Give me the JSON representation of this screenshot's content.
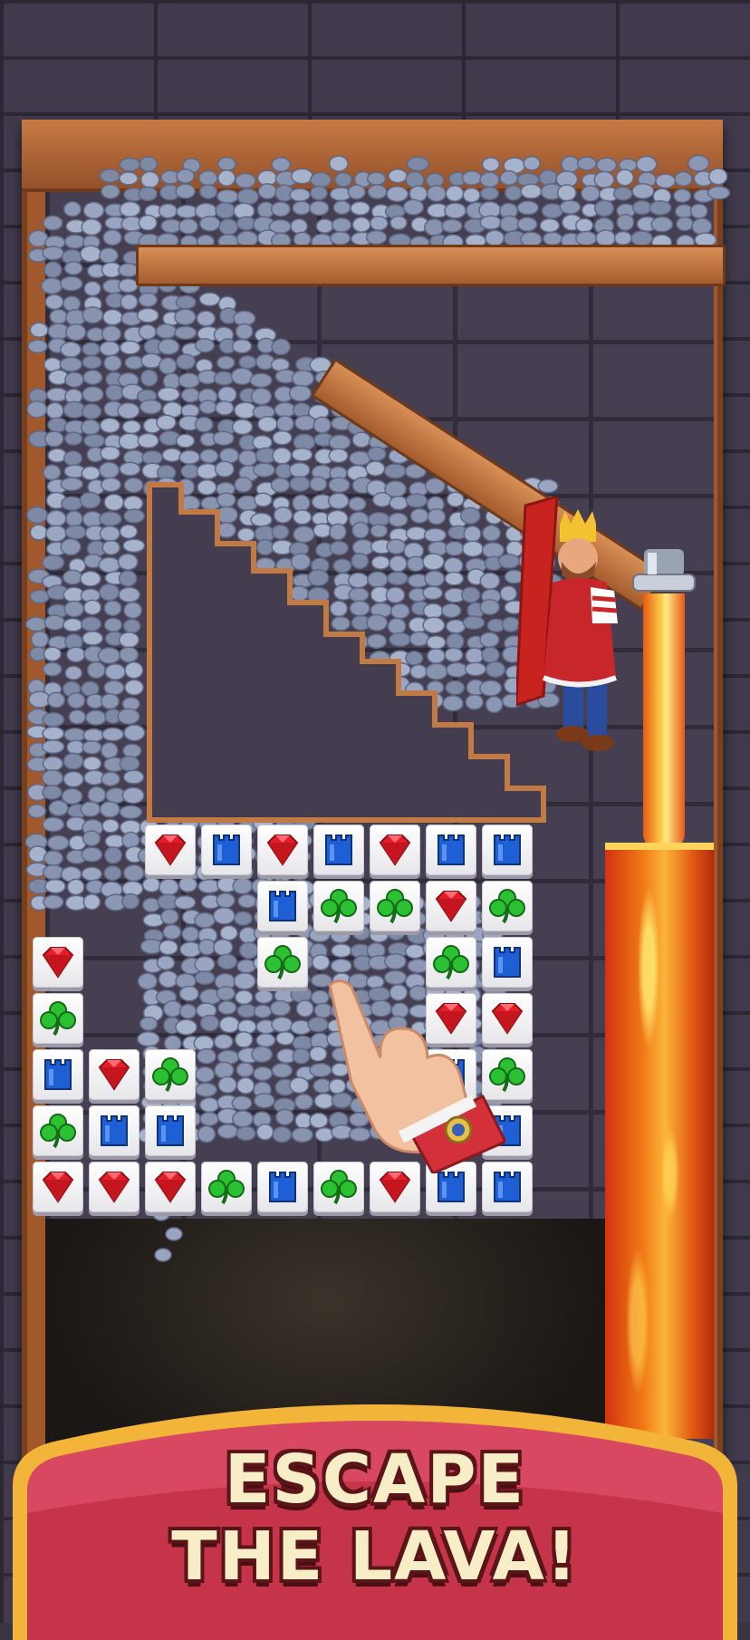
{
  "banner": {
    "line1": "ESCAPE",
    "line2": "THE LAVA!"
  },
  "colors": {
    "banner_red": "#c6344a",
    "banner_gold": "#f3b43a",
    "lava": "#f07a16",
    "stone": "#8d98b3",
    "wood": "#c27a45"
  },
  "board": {
    "rows": [
      [
        "",
        "",
        "",
        "gem",
        "tower",
        "gem",
        "tower",
        "gem",
        "tower",
        "tower"
      ],
      [
        "",
        "",
        "",
        "",
        "",
        "tower",
        "clover",
        "clover",
        "gem",
        "clover"
      ],
      [
        "",
        "gem",
        "",
        "",
        "",
        "clover",
        "",
        "",
        "clover",
        "tower"
      ],
      [
        "",
        "clover",
        "",
        "",
        "",
        "",
        "",
        "",
        "gem",
        "gem"
      ],
      [
        "",
        "tower",
        "gem",
        "clover",
        "",
        "",
        "",
        "clover",
        "tower",
        "clover"
      ],
      [
        "",
        "clover",
        "tower",
        "tower",
        "",
        "",
        "",
        "",
        "",
        "tower"
      ],
      [
        "",
        "gem",
        "gem",
        "gem",
        "clover",
        "tower",
        "clover",
        "gem",
        "tower",
        "tower"
      ]
    ]
  },
  "icons": {
    "gem": "red-gem-icon",
    "tower": "blue-tower-icon",
    "clover": "green-clover-icon"
  },
  "hint": "tap-hand-icon"
}
